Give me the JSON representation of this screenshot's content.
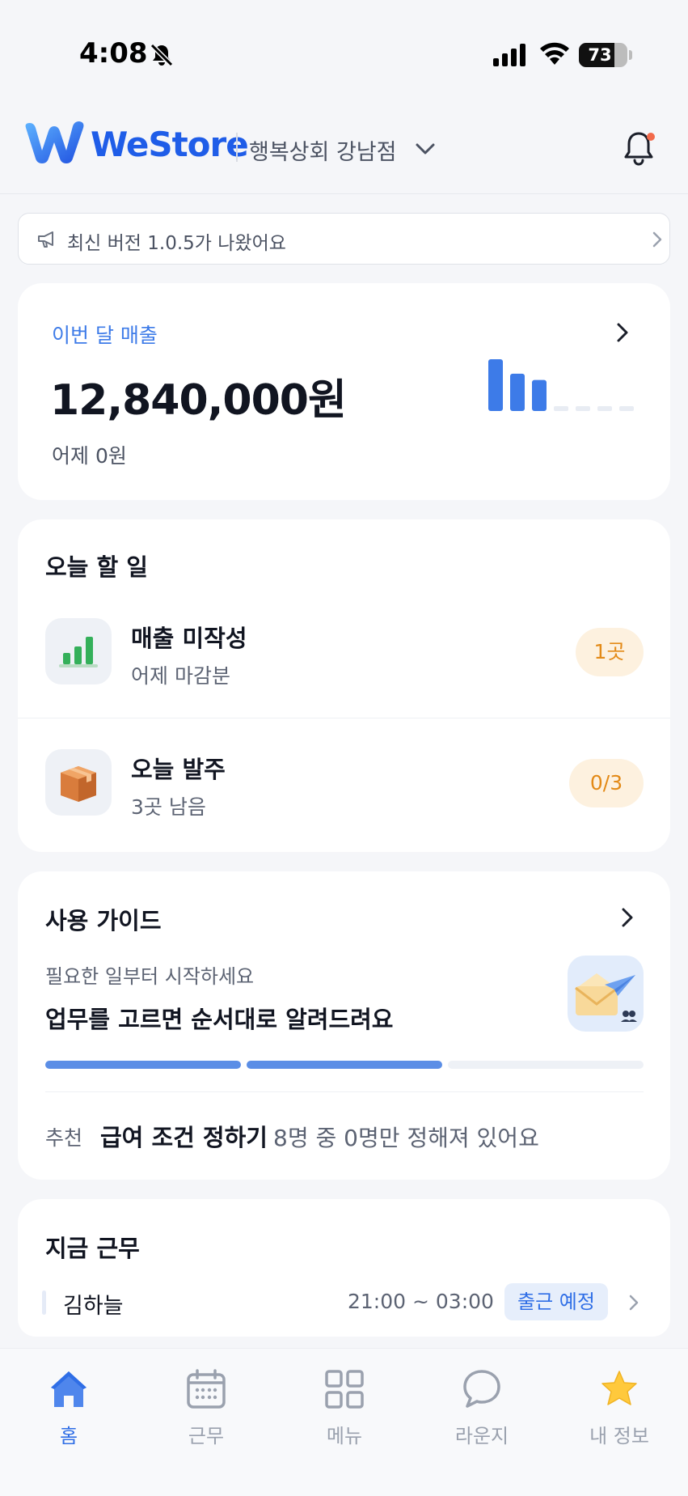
{
  "status_bar": {
    "time": "4:08",
    "battery": "73",
    "battery_level": 0.73,
    "icons": [
      "bell-slash-icon",
      "cellular-signal-icon",
      "wifi-icon",
      "battery-icon"
    ]
  },
  "header": {
    "logo_text": "WeStore",
    "store_name": "행복상회 강남점",
    "icons": [
      "westore-logo-icon",
      "chevron-down-icon",
      "bell-icon"
    ],
    "has_notification_dot": true
  },
  "notice": {
    "text": "최신 버전 1.0.5가 나왔어요",
    "icons": [
      "megaphone-icon",
      "chevron-right-icon"
    ]
  },
  "sales": {
    "label": "이번 달 매출",
    "amount": "12,840,000원",
    "yesterday": "어제 0원",
    "mini_chart": {
      "type": "bar",
      "values": [
        1.0,
        0.72,
        0.6,
        0,
        0,
        0,
        0
      ],
      "filled_count": 3
    }
  },
  "todo": {
    "title": "오늘 할 일",
    "items": [
      {
        "name": "매출 미작성",
        "sub": "어제 마감분",
        "badge": "1곳",
        "icon": "bar-chart-icon"
      },
      {
        "name": "오늘 발주",
        "sub": "3곳 남음",
        "badge": "0/3",
        "icon": "package-box-icon"
      }
    ]
  },
  "guide": {
    "title": "사용 가이드",
    "subtitle": "필요한 일부터 시작하세요",
    "main": "업무를 고르면 순서대로 알려드려요",
    "illustration_icon": "envelope-paper-plane-icon",
    "progress_steps": 3,
    "progress_completed": 2,
    "recommend_label": "추천",
    "recommend_title": "급여 조건 정하기",
    "recommend_desc": "8명 중 0명만 정해져 있어요"
  },
  "work_now": {
    "title": "지금 근무",
    "employee": "김하늘",
    "time": "21:00 ~ 03:00",
    "status": "출근 예정"
  },
  "tabs": [
    {
      "label": "홈",
      "icon": "home-icon",
      "active": true
    },
    {
      "label": "근무",
      "icon": "calendar-icon",
      "active": false
    },
    {
      "label": "메뉴",
      "icon": "grid-icon",
      "active": false
    },
    {
      "label": "라운지",
      "icon": "chat-bubble-icon",
      "active": false
    },
    {
      "label": "내 정보",
      "icon": "star-icon",
      "active": false
    }
  ],
  "colors": {
    "brand_blue": "#1f5de8",
    "accent_blue": "#3d7be8",
    "badge_orange_bg": "#fdf1df",
    "badge_orange_text": "#e38a17",
    "page_bg": "#f5f6f9",
    "card_bg": "#ffffff",
    "progress_done": "#5b8ee6",
    "progress_todo": "#eef1f6"
  }
}
